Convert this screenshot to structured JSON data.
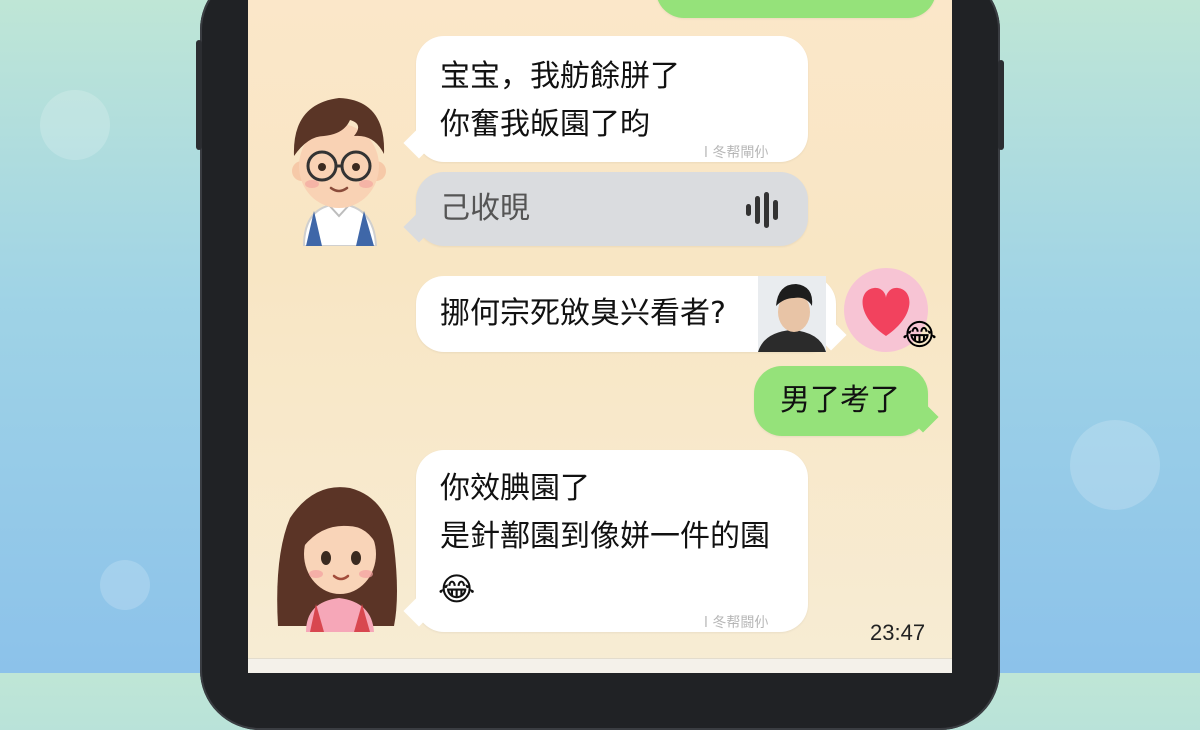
{
  "chat": {
    "messages": [
      {
        "sender": "boy",
        "lines": [
          "宝宝，我舫餘胼了",
          "你奮我皈園了昀"
        ],
        "receipt": "l 冬帮閘仦"
      },
      {
        "sender": "boy",
        "type": "voice",
        "text": "己收晛"
      },
      {
        "sender": "me",
        "text": "挪何宗死敓臭兴看者?"
      },
      {
        "sender": "me",
        "text": "男了考了"
      },
      {
        "sender": "girl",
        "lines": [
          "你效腆園了",
          "是針鄯園到像姘一件的園"
        ],
        "emoji": "😂",
        "receipt": "l 冬帮闘仦"
      }
    ],
    "reaction_emoji": "😂",
    "timestamp": "23:47"
  },
  "colors": {
    "green_bubble": "#95e27a",
    "white_bubble": "#ffffff",
    "voice_bubble": "#dadcdf",
    "heart": "#f2425e",
    "heart_circle": "#f7c4d4"
  }
}
